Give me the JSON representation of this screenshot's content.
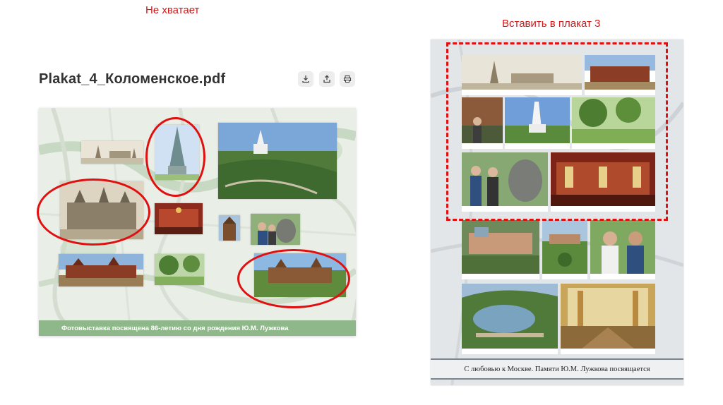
{
  "labels": {
    "missing": "Не хватает",
    "insert": "Вставить в плакат 3"
  },
  "file": {
    "title": "Plakat_4_Коломенское.pdf",
    "actions": [
      {
        "icon": "download-icon"
      },
      {
        "icon": "share-icon"
      },
      {
        "icon": "print-icon"
      }
    ]
  },
  "poster_left": {
    "footer_text": "Фотовыставка посвящена 86-летию со дня рождения Ю.М. Лужкова"
  },
  "poster_right": {
    "footer_text": "С любовью к Москве. Памяти Ю.М. Лужкова посвящается"
  },
  "colors": {
    "annotation": "#e01010",
    "poster_footer": "#8fb88a"
  }
}
